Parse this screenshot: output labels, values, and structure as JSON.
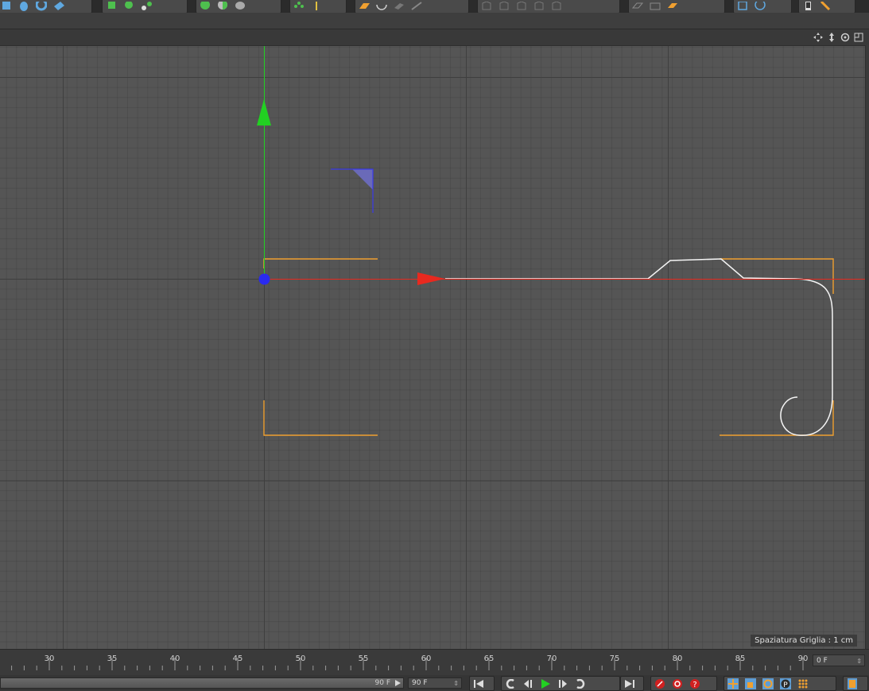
{
  "viewport": {
    "grid_spacing_label": "Spaziatura Griglia : 1 cm"
  },
  "timeline": {
    "ruler_labels": [
      "30",
      "35",
      "40",
      "45",
      "50",
      "55",
      "60",
      "65",
      "70",
      "75",
      "80",
      "85",
      "90"
    ],
    "current_frame": "0 F",
    "end_frame_slider": "90 F",
    "end_frame_field": "90 F"
  },
  "colors": {
    "viewport_bg": "#555555",
    "axis_x": "#e8291f",
    "axis_y": "#22d022",
    "object_highlight": "#f0a030",
    "spline": "#ffffff",
    "handle": "#2a2af0"
  }
}
